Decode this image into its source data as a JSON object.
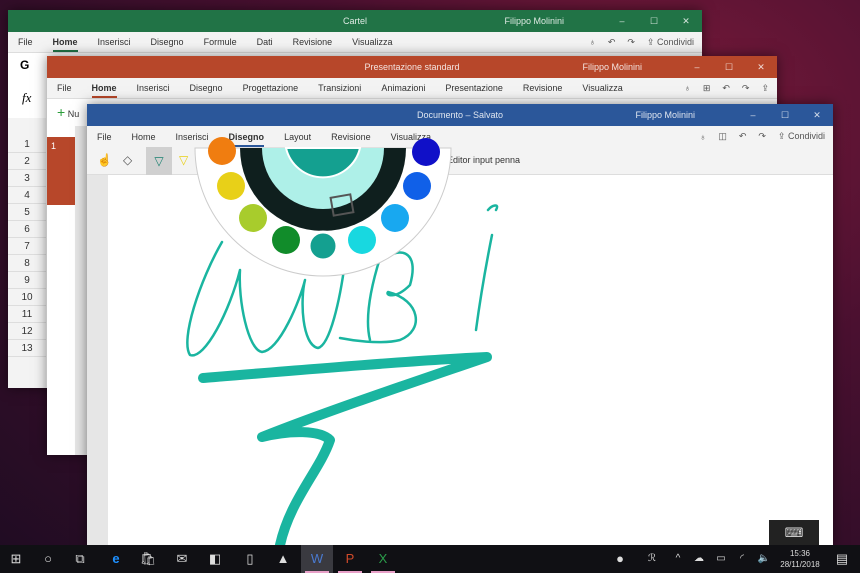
{
  "excel": {
    "title": "Cartel",
    "user": "Filippo Molinini",
    "accent": "#217346",
    "tabs": [
      "File",
      "Home",
      "Inserisci",
      "Disegno",
      "Formule",
      "Dati",
      "Revisione",
      "Visualizza"
    ],
    "active_tab": "Home",
    "share": "Condividi",
    "font_label": "G",
    "fx": "fx",
    "rows": [
      "1",
      "2",
      "3",
      "4",
      "5",
      "6",
      "7",
      "8",
      "9",
      "10",
      "11",
      "12",
      "13"
    ]
  },
  "ppt": {
    "title": "Presentazione standard",
    "user": "Filippo Molinini",
    "accent": "#b7472a",
    "tabs": [
      "File",
      "Home",
      "Inserisci",
      "Disegno",
      "Progettazione",
      "Transizioni",
      "Animazioni",
      "Presentazione",
      "Revisione",
      "Visualizza"
    ],
    "active_tab": "Home",
    "new_slide": "Nu",
    "slide_number": "1"
  },
  "word": {
    "title": "Documento – Salvato",
    "user": "Filippo Molinini",
    "accent": "#2b579a",
    "tabs": [
      "File",
      "Home",
      "Inserisci",
      "Disegno",
      "Layout",
      "Revisione",
      "Visualizza"
    ],
    "active_tab": "Disegno",
    "share": "Condividi",
    "pen_editor": "Editor input penna",
    "ink_color": "#1ab5a0"
  },
  "palette": {
    "colors": [
      "#f07d10",
      "#e8d018",
      "#a8cc2c",
      "#118c2a",
      "#14a090",
      "#18d8e0",
      "#18a8f0",
      "#1060e8",
      "#1010c8"
    ],
    "selected": "#14a090"
  },
  "taskbar": {
    "time": "15:36",
    "date": "28/11/2018"
  },
  "controls": {
    "min": "–",
    "max": "☐",
    "close": "✕"
  }
}
